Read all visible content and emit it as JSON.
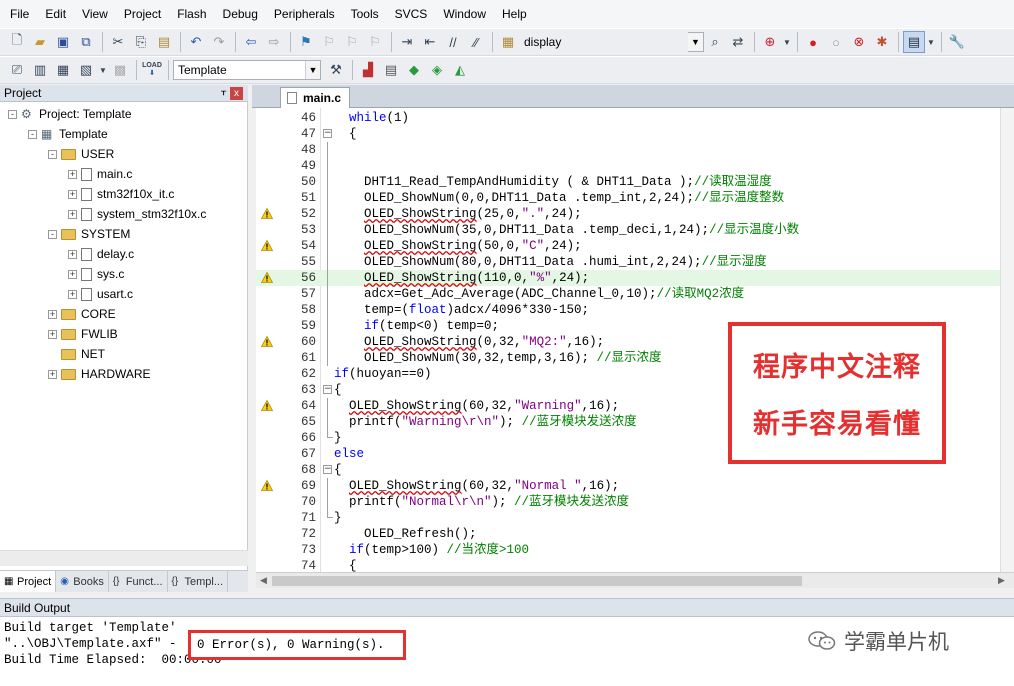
{
  "menu": [
    "File",
    "Edit",
    "View",
    "Project",
    "Flash",
    "Debug",
    "Peripherals",
    "Tools",
    "SVCS",
    "Window",
    "Help"
  ],
  "toolbar1": {
    "find_combo": "display"
  },
  "toolbar2": {
    "target_combo": "Template",
    "load_label": "LOAD"
  },
  "project_panel": {
    "title": "Project",
    "pin": "ᚁ",
    "close": "x",
    "tree": [
      {
        "label": "Project: Template",
        "kind": "project",
        "level": 0,
        "expander": "-"
      },
      {
        "label": "Template",
        "kind": "target",
        "level": 1,
        "expander": "-"
      },
      {
        "label": "USER",
        "kind": "folder",
        "level": 2,
        "expander": "-"
      },
      {
        "label": "main.c",
        "kind": "file",
        "level": 3,
        "expander": "+"
      },
      {
        "label": "stm32f10x_it.c",
        "kind": "file",
        "level": 3,
        "expander": "+"
      },
      {
        "label": "system_stm32f10x.c",
        "kind": "file",
        "level": 3,
        "expander": "+"
      },
      {
        "label": "SYSTEM",
        "kind": "folder",
        "level": 2,
        "expander": "-"
      },
      {
        "label": "delay.c",
        "kind": "file",
        "level": 3,
        "expander": "+"
      },
      {
        "label": "sys.c",
        "kind": "file",
        "level": 3,
        "expander": "+"
      },
      {
        "label": "usart.c",
        "kind": "file",
        "level": 3,
        "expander": "+"
      },
      {
        "label": "CORE",
        "kind": "folder",
        "level": 2,
        "expander": "+"
      },
      {
        "label": "FWLIB",
        "kind": "folder",
        "level": 2,
        "expander": "+"
      },
      {
        "label": "NET",
        "kind": "folder",
        "level": 2,
        "expander": ""
      },
      {
        "label": "HARDWARE",
        "kind": "folder",
        "level": 2,
        "expander": "+"
      }
    ],
    "tabs": [
      "Project",
      "Books",
      "Funct...",
      "Templ..."
    ]
  },
  "editor": {
    "tab": "main.c",
    "lines": [
      {
        "n": "46",
        "text": "  while(1)",
        "warn": false
      },
      {
        "n": "47",
        "text": "  {",
        "warn": false
      },
      {
        "n": "48",
        "text": "",
        "warn": false
      },
      {
        "n": "49",
        "text": "",
        "warn": false
      },
      {
        "n": "50",
        "text": "    DHT11_Read_TempAndHumidity ( & DHT11_Data );//读取温湿度",
        "warn": false
      },
      {
        "n": "51",
        "text": "    OLED_ShowNum(0,0,DHT11_Data .temp_int,2,24);//显示温度整数",
        "warn": false
      },
      {
        "n": "52",
        "text": "    OLED_ShowString(25,0,\".\",24);",
        "warn": true
      },
      {
        "n": "53",
        "text": "    OLED_ShowNum(35,0,DHT11_Data .temp_deci,1,24);//显示温度小数",
        "warn": false
      },
      {
        "n": "54",
        "text": "    OLED_ShowString(50,0,\"C\",24);",
        "warn": true
      },
      {
        "n": "55",
        "text": "    OLED_ShowNum(80,0,DHT11_Data .humi_int,2,24);//显示湿度",
        "warn": false
      },
      {
        "n": "56",
        "text": "    OLED_ShowString(110,0,\"%\",24);",
        "warn": true
      },
      {
        "n": "57",
        "text": "    adcx=Get_Adc_Average(ADC_Channel_0,10);//读取MQ2浓度",
        "warn": false
      },
      {
        "n": "58",
        "text": "    temp=(float)adcx/4096*330-150;",
        "warn": false
      },
      {
        "n": "59",
        "text": "    if(temp<0) temp=0;",
        "warn": false
      },
      {
        "n": "60",
        "text": "    OLED_ShowString(0,32,\"MQ2:\",16);",
        "warn": true
      },
      {
        "n": "61",
        "text": "    OLED_ShowNum(30,32,temp,3,16); //显示浓度",
        "warn": false
      },
      {
        "n": "62",
        "text": "if(huoyan==0)",
        "warn": false
      },
      {
        "n": "63",
        "text": "{",
        "warn": false
      },
      {
        "n": "64",
        "text": "  OLED_ShowString(60,32,\"Warning\",16);",
        "warn": true
      },
      {
        "n": "65",
        "text": "  printf(\"Warning\\r\\n\"); //蓝牙模块发送浓度",
        "warn": false
      },
      {
        "n": "66",
        "text": "}",
        "warn": false
      },
      {
        "n": "67",
        "text": "else",
        "warn": false
      },
      {
        "n": "68",
        "text": "{",
        "warn": false
      },
      {
        "n": "69",
        "text": "  OLED_ShowString(60,32,\"Normal \",16);",
        "warn": true
      },
      {
        "n": "70",
        "text": "  printf(\"Normal\\r\\n\"); //蓝牙模块发送浓度",
        "warn": false
      },
      {
        "n": "71",
        "text": "}",
        "warn": false
      },
      {
        "n": "72",
        "text": "    OLED_Refresh();",
        "warn": false
      },
      {
        "n": "73",
        "text": "  if(temp>100) //当浓度>100",
        "warn": false
      },
      {
        "n": "74",
        "text": "  {",
        "warn": false
      }
    ]
  },
  "annotation": {
    "line1": "程序中文注释",
    "line2": "新手容易看懂"
  },
  "build_output": {
    "title": "Build Output",
    "line1": "Build target 'Template'",
    "line2": "\"..\\OBJ\\Template.axf\" -",
    "line3": "Build Time Elapsed:  00:00:00",
    "result": "0 Error(s), 0 Warning(s)."
  },
  "watermark": "学霸单片机",
  "colors": {
    "accent_red": "#e53030",
    "keyword": "#0000ff",
    "comment": "#008000",
    "string": "#800080",
    "current_line": "#e4f7e4"
  }
}
